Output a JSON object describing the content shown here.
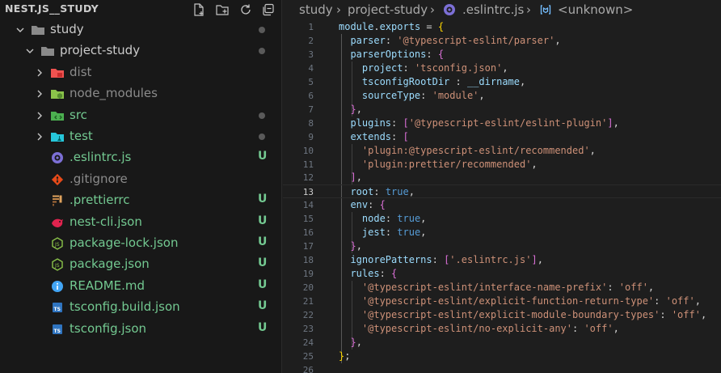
{
  "explorer": {
    "title": "NEST.JS__STUDY",
    "actions": [
      {
        "icon": "new-file-icon"
      },
      {
        "icon": "new-folder-icon"
      },
      {
        "icon": "refresh-icon"
      },
      {
        "icon": "collapse-all-icon"
      }
    ],
    "tree": [
      {
        "label": "study",
        "kind": "folder",
        "expanded": true,
        "depth": 0,
        "status": "dot",
        "icon": "folder-icon"
      },
      {
        "label": "project-study",
        "kind": "folder",
        "expanded": true,
        "depth": 1,
        "status": "dot",
        "icon": "folder-icon"
      },
      {
        "label": "dist",
        "kind": "folder",
        "expanded": false,
        "depth": 2,
        "status": "",
        "icon": "dist-folder-icon",
        "dim": true
      },
      {
        "label": "node_modules",
        "kind": "folder",
        "expanded": false,
        "depth": 2,
        "status": "",
        "icon": "node-modules-folder-icon",
        "dim": true
      },
      {
        "label": "src",
        "kind": "folder",
        "expanded": false,
        "depth": 2,
        "status": "dot",
        "icon": "src-folder-icon"
      },
      {
        "label": "test",
        "kind": "folder",
        "expanded": false,
        "depth": 2,
        "status": "dot",
        "icon": "test-folder-icon"
      },
      {
        "label": ".eslintrc.js",
        "kind": "file",
        "depth": 2,
        "status": "U",
        "icon": "eslint-icon"
      },
      {
        "label": ".gitignore",
        "kind": "file",
        "depth": 2,
        "status": "",
        "icon": "git-icon",
        "dim": true
      },
      {
        "label": ".prettierrc",
        "kind": "file",
        "depth": 2,
        "status": "U",
        "icon": "prettier-icon"
      },
      {
        "label": "nest-cli.json",
        "kind": "file",
        "depth": 2,
        "status": "U",
        "icon": "nestjs-icon"
      },
      {
        "label": "package-lock.json",
        "kind": "file",
        "depth": 2,
        "status": "U",
        "icon": "nodejs-icon"
      },
      {
        "label": "package.json",
        "kind": "file",
        "depth": 2,
        "status": "U",
        "icon": "nodejs-icon"
      },
      {
        "label": "README.md",
        "kind": "file",
        "depth": 2,
        "status": "U",
        "icon": "info-icon"
      },
      {
        "label": "tsconfig.build.json",
        "kind": "file",
        "depth": 2,
        "status": "U",
        "icon": "tsconfig-icon"
      },
      {
        "label": "tsconfig.json",
        "kind": "file",
        "depth": 2,
        "status": "U",
        "icon": "tsconfig-icon"
      }
    ]
  },
  "breadcrumb": {
    "items": [
      "study",
      "project-study",
      ".eslintrc.js",
      "<unknown>"
    ],
    "separator": "›"
  },
  "editor": {
    "active_line": 13,
    "lines": [
      [
        [
          "id",
          "module"
        ],
        [
          "pun",
          "."
        ],
        [
          "id",
          "exports"
        ],
        [
          "pun",
          " = "
        ],
        [
          "brk1",
          "{"
        ]
      ],
      [
        [
          "pun",
          "  "
        ],
        [
          "id",
          "parser"
        ],
        [
          "pun",
          ": "
        ],
        [
          "str",
          "'@typescript-eslint/parser'"
        ],
        [
          "pun",
          ","
        ]
      ],
      [
        [
          "pun",
          "  "
        ],
        [
          "id",
          "parserOptions"
        ],
        [
          "pun",
          ": "
        ],
        [
          "brk2",
          "{"
        ]
      ],
      [
        [
          "pun",
          "    "
        ],
        [
          "id",
          "project"
        ],
        [
          "pun",
          ": "
        ],
        [
          "str",
          "'tsconfig.json'"
        ],
        [
          "pun",
          ","
        ]
      ],
      [
        [
          "pun",
          "    "
        ],
        [
          "id",
          "tsconfigRootDir"
        ],
        [
          "pun",
          " : "
        ],
        [
          "id",
          "__dirname"
        ],
        [
          "pun",
          ","
        ]
      ],
      [
        [
          "pun",
          "    "
        ],
        [
          "id",
          "sourceType"
        ],
        [
          "pun",
          ": "
        ],
        [
          "str",
          "'module'"
        ],
        [
          "pun",
          ","
        ]
      ],
      [
        [
          "pun",
          "  "
        ],
        [
          "brk2",
          "}"
        ],
        [
          "pun",
          ","
        ]
      ],
      [
        [
          "pun",
          "  "
        ],
        [
          "id",
          "plugins"
        ],
        [
          "pun",
          ": "
        ],
        [
          "brk2",
          "["
        ],
        [
          "str",
          "'@typescript-eslint/eslint-plugin'"
        ],
        [
          "brk2",
          "]"
        ],
        [
          "pun",
          ","
        ]
      ],
      [
        [
          "pun",
          "  "
        ],
        [
          "id",
          "extends"
        ],
        [
          "pun",
          ": "
        ],
        [
          "brk2",
          "["
        ]
      ],
      [
        [
          "pun",
          "    "
        ],
        [
          "str",
          "'plugin:@typescript-eslint/recommended'"
        ],
        [
          "pun",
          ","
        ]
      ],
      [
        [
          "pun",
          "    "
        ],
        [
          "str",
          "'plugin:prettier/recommended'"
        ],
        [
          "pun",
          ","
        ]
      ],
      [
        [
          "pun",
          "  "
        ],
        [
          "brk2",
          "]"
        ],
        [
          "pun",
          ","
        ]
      ],
      [
        [
          "pun",
          "  "
        ],
        [
          "id",
          "root"
        ],
        [
          "pun",
          ": "
        ],
        [
          "kw",
          "true"
        ],
        [
          "pun",
          ","
        ]
      ],
      [
        [
          "pun",
          "  "
        ],
        [
          "id",
          "env"
        ],
        [
          "pun",
          ": "
        ],
        [
          "brk2",
          "{"
        ]
      ],
      [
        [
          "pun",
          "    "
        ],
        [
          "id",
          "node"
        ],
        [
          "pun",
          ": "
        ],
        [
          "kw",
          "true"
        ],
        [
          "pun",
          ","
        ]
      ],
      [
        [
          "pun",
          "    "
        ],
        [
          "id",
          "jest"
        ],
        [
          "pun",
          ": "
        ],
        [
          "kw",
          "true"
        ],
        [
          "pun",
          ","
        ]
      ],
      [
        [
          "pun",
          "  "
        ],
        [
          "brk2",
          "}"
        ],
        [
          "pun",
          ","
        ]
      ],
      [
        [
          "pun",
          "  "
        ],
        [
          "id",
          "ignorePatterns"
        ],
        [
          "pun",
          ": "
        ],
        [
          "brk2",
          "["
        ],
        [
          "str",
          "'.eslintrc.js'"
        ],
        [
          "brk2",
          "]"
        ],
        [
          "pun",
          ","
        ]
      ],
      [
        [
          "pun",
          "  "
        ],
        [
          "id",
          "rules"
        ],
        [
          "pun",
          ": "
        ],
        [
          "brk2",
          "{"
        ]
      ],
      [
        [
          "pun",
          "    "
        ],
        [
          "str",
          "'@typescript-eslint/interface-name-prefix'"
        ],
        [
          "pun",
          ": "
        ],
        [
          "str",
          "'off'"
        ],
        [
          "pun",
          ","
        ]
      ],
      [
        [
          "pun",
          "    "
        ],
        [
          "str",
          "'@typescript-eslint/explicit-function-return-type'"
        ],
        [
          "pun",
          ": "
        ],
        [
          "str",
          "'off'"
        ],
        [
          "pun",
          ","
        ]
      ],
      [
        [
          "pun",
          "    "
        ],
        [
          "str",
          "'@typescript-eslint/explicit-module-boundary-types'"
        ],
        [
          "pun",
          ": "
        ],
        [
          "str",
          "'off'"
        ],
        [
          "pun",
          ","
        ]
      ],
      [
        [
          "pun",
          "    "
        ],
        [
          "str",
          "'@typescript-eslint/no-explicit-any'"
        ],
        [
          "pun",
          ": "
        ],
        [
          "str",
          "'off'"
        ],
        [
          "pun",
          ","
        ]
      ],
      [
        [
          "pun",
          "  "
        ],
        [
          "brk2",
          "}"
        ],
        [
          "pun",
          ","
        ]
      ],
      [
        [
          "brk1",
          "}"
        ],
        [
          "pun",
          ";"
        ]
      ],
      []
    ]
  },
  "colors": {
    "folder_study": "#8a8a8a",
    "src_folder": "#4caf50",
    "test_folder": "#26c6da",
    "dist_folder": "#ef5350",
    "node_modules_folder": "#8bc34a",
    "untracked": "#73c991",
    "dim_text": "#8b8b8b",
    "dot": "#5a5a5a"
  }
}
